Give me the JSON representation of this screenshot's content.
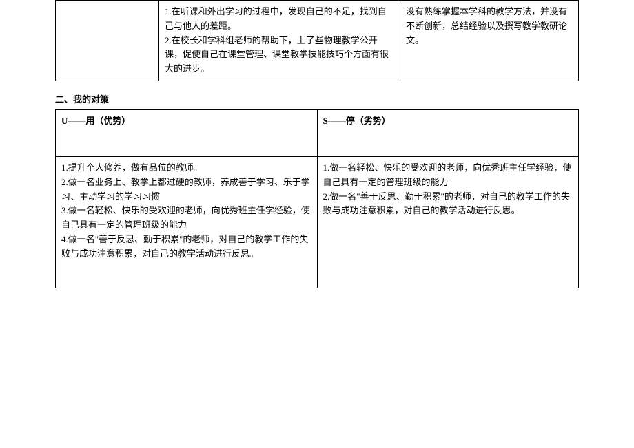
{
  "table1": {
    "row1": {
      "col1": "",
      "col2": "1.在听课和外出学习的过程中，发现自己的不足，找到自己与他人的差距。\n2.在校长和学科组老师的帮助下，上了些物理教学公开课，促使自己在课堂管理、课堂教学技能技巧个方面有很大的进步。",
      "col3": "没有熟练掌握本学科的教学方法，并没有不断创新，总结经验以及撰写教学教研论文。"
    }
  },
  "section_title": "二、我的对策",
  "table2": {
    "header": {
      "col1": "U——用（优势）",
      "col2": "S——停（劣势）"
    },
    "body": {
      "col1": "1.提升个人修养，做有品位的教师。\n2.做一名业务上、教学上都过硬的教师，养成善于学习、乐于学习、主动学习的学习习惯\n3.做一名轻松、快乐的受欢迎的老师，向优秀班主任学经验，使自己具有一定的管理班级的能力\n4.做一名\"善于反思、勤于积累\"的老师，对自己的教学工作的失败与成功注意积累，对自己的教学活动进行反思。",
      "col2": "1.做一名轻松、快乐的受欢迎的老师，向优秀班主任学经验，使自己具有一定的管理班级的能力\n2.做一名\"善于反思、勤于积累\"的老师，对自己的教学工作的失败与成功注意积累，对自己的教学活动进行反思。"
    }
  }
}
